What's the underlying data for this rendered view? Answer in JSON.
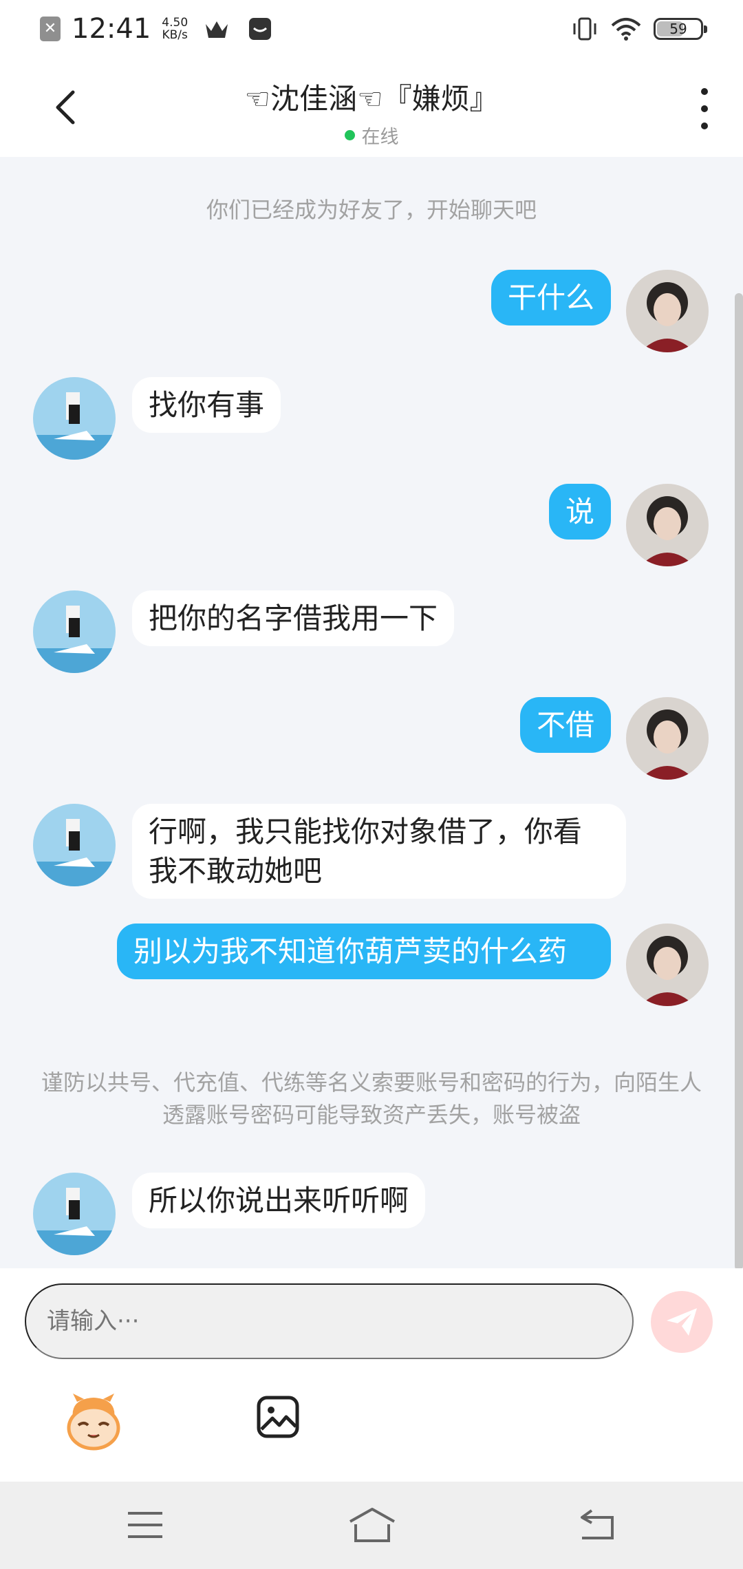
{
  "status_bar": {
    "time": "12:41",
    "net_speed_value": "4.50",
    "net_speed_unit": "KB/s",
    "battery": "59",
    "icons": [
      "close-notification-icon",
      "crown-icon",
      "mail-icon",
      "vibrate-icon",
      "wifi-icon",
      "battery-icon"
    ]
  },
  "header": {
    "title": "☜沈佳涵☜『嫌烦』",
    "status": "在线",
    "status_color": "#21c45a"
  },
  "chat": {
    "system_notice_top": "你们已经成为好友了，开始聊天吧",
    "messages": [
      {
        "direction": "out",
        "text": "干什么"
      },
      {
        "direction": "in",
        "text": "找你有事"
      },
      {
        "direction": "out",
        "text": "说"
      },
      {
        "direction": "in",
        "text": "把你的名字借我用一下"
      },
      {
        "direction": "out",
        "text": "不借"
      },
      {
        "direction": "in",
        "text": "行啊，我只能找你对象借了，你看我不敢动她吧"
      },
      {
        "direction": "out",
        "text": "别以为我不知道你葫芦荬的什么药"
      },
      {
        "direction": "in",
        "text": "所以你说出来听听啊"
      }
    ],
    "system_notice_warning": "谨防以共号、代充值、代练等名义索要账号和密码的行为，向陌生人透露账号密码可能导致资产丢失，账号被盗"
  },
  "input": {
    "placeholder": "请输入···"
  },
  "colors": {
    "outgoing_bubble": "#29b6f6",
    "incoming_bubble": "#ffffff",
    "background": "#f3f5f9",
    "send_button": "#ffd9d9"
  }
}
